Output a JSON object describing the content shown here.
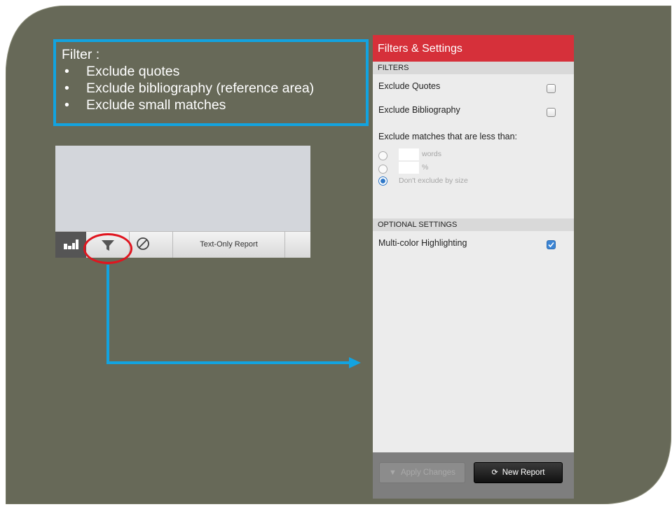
{
  "callout": {
    "title": "Filter :",
    "bullets": [
      "Exclude quotes",
      "Exclude bibliography (reference area)",
      "Exclude small matches"
    ]
  },
  "toolbar": {
    "text_only_label": "Text-Only Report"
  },
  "panel": {
    "title": "Filters & Settings",
    "filters_header": "FILTERS",
    "exclude_quotes": {
      "label": "Exclude Quotes",
      "checked": false
    },
    "exclude_bibliography": {
      "label": "Exclude Bibliography",
      "checked": false
    },
    "exclude_small_label": "Exclude matches that are less than:",
    "words_label": "words",
    "percent_label": "%",
    "dont_exclude_label": "Don't exclude by size",
    "optional_header": "OPTIONAL SETTINGS",
    "multicolor": {
      "label": "Multi-color Highlighting",
      "checked": true
    },
    "apply_label": "Apply Changes",
    "new_report_label": "New Report"
  },
  "colors": {
    "slide_bg": "#676958",
    "callout_border": "#12a3e0",
    "panel_header": "#d6303a",
    "highlight_circle": "#e0151f",
    "arrow": "#12a3e0"
  }
}
